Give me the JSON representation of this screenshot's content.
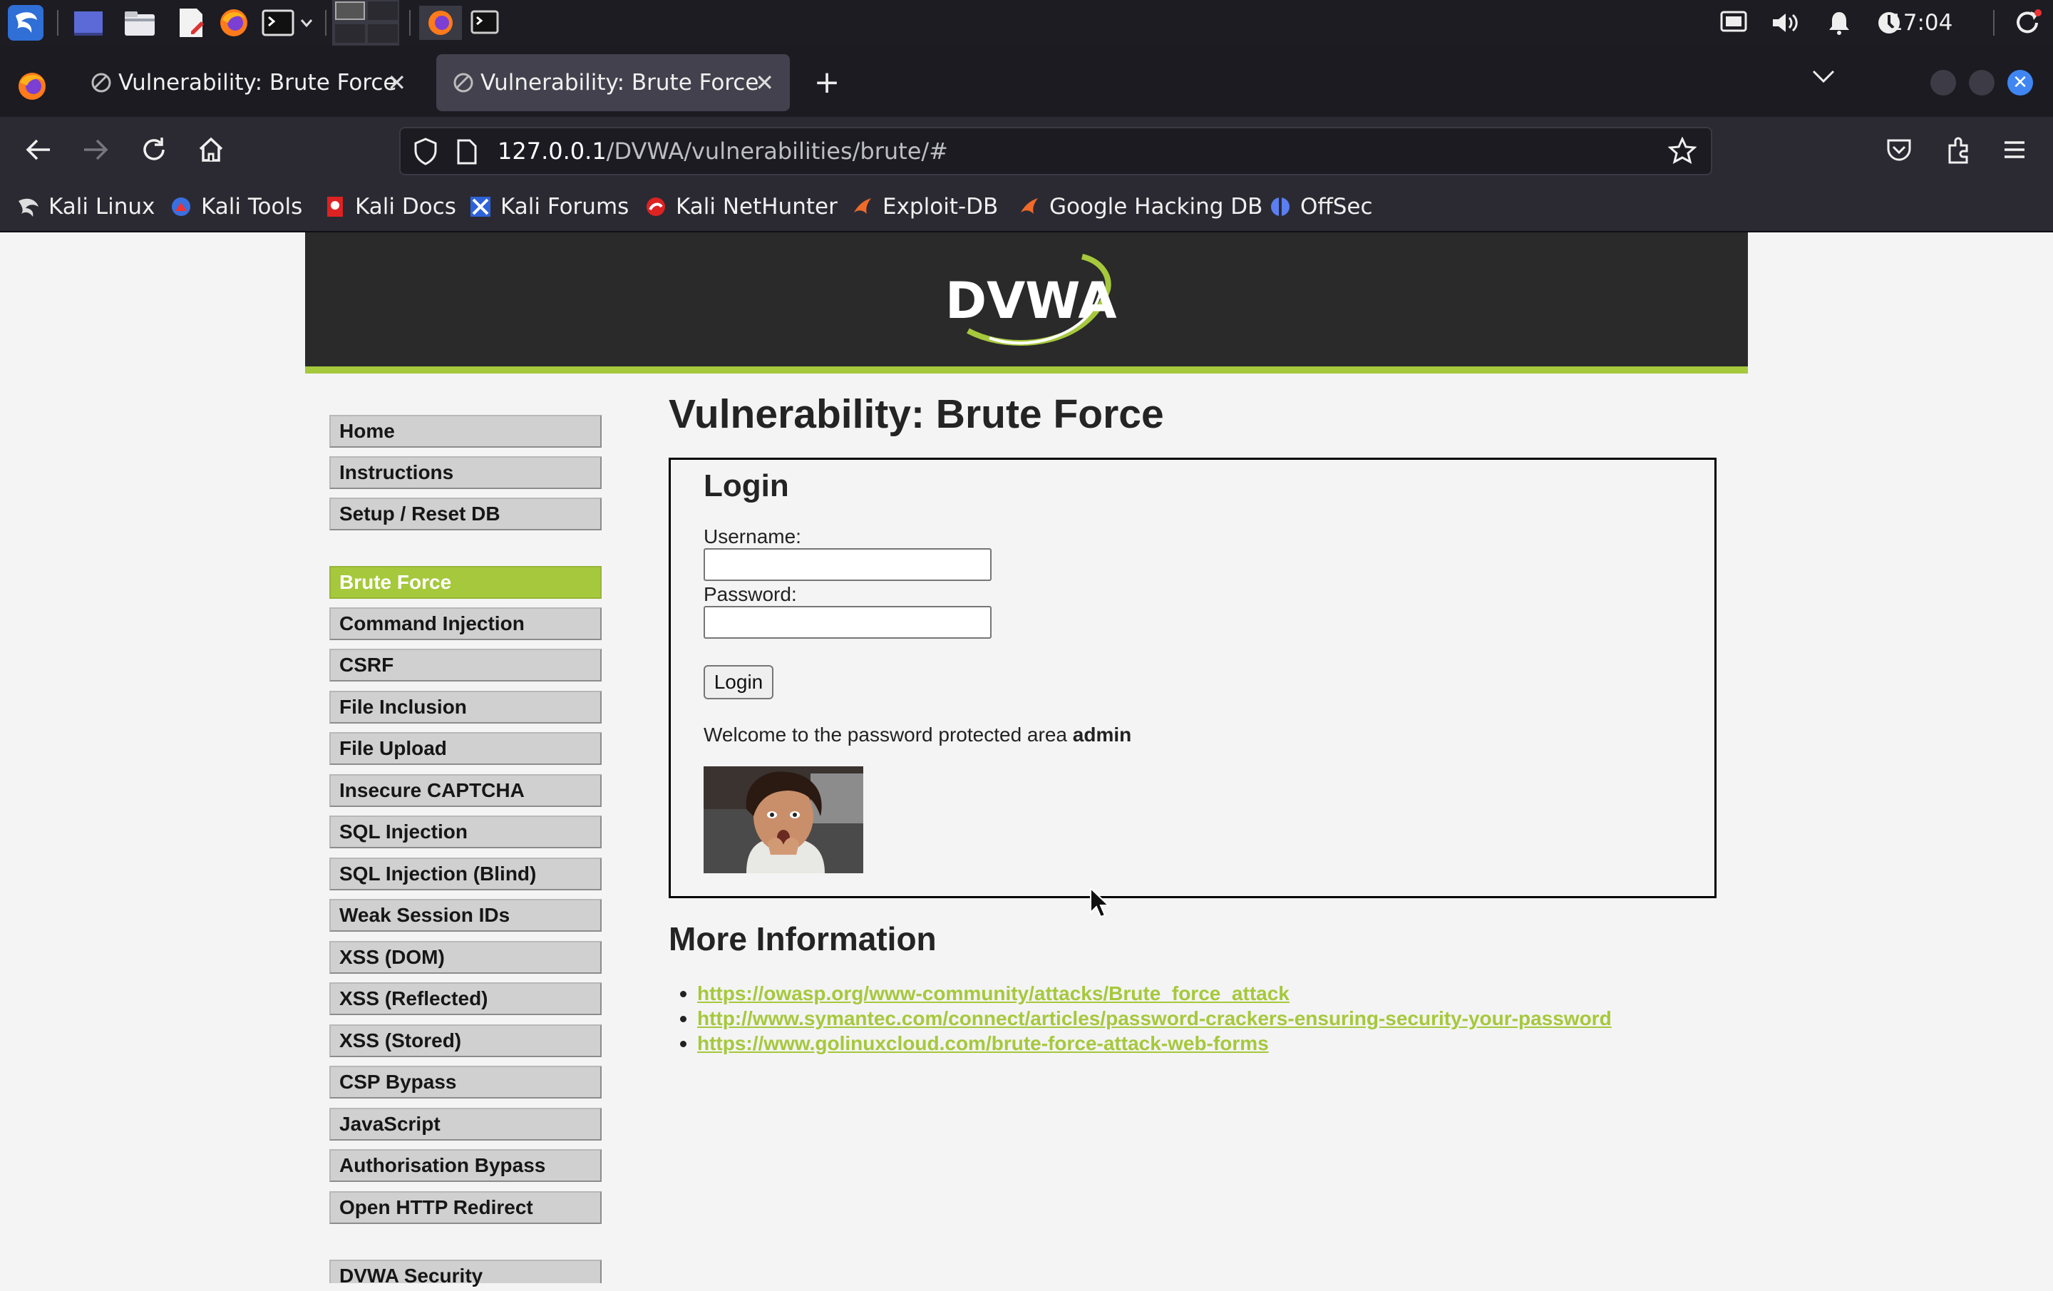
{
  "taskbar": {
    "clock": "17:04"
  },
  "tabs": [
    {
      "title": "Vulnerability: Brute Force",
      "active": false
    },
    {
      "title": "Vulnerability: Brute Force",
      "active": true
    }
  ],
  "nav": {
    "url_host": "127.0.0.1",
    "url_path": "/DVWA/vulnerabilities/brute/#"
  },
  "bookmarks": [
    "Kali Linux",
    "Kali Tools",
    "Kali Docs",
    "Kali Forums",
    "Kali NetHunter",
    "Exploit-DB",
    "Google Hacking DB",
    "OffSec"
  ],
  "header": {
    "logo_text": "DVWA"
  },
  "menu": {
    "group1": [
      "Home",
      "Instructions",
      "Setup / Reset DB"
    ],
    "group2": [
      "Brute Force",
      "Command Injection",
      "CSRF",
      "File Inclusion",
      "File Upload",
      "Insecure CAPTCHA",
      "SQL Injection",
      "SQL Injection (Blind)",
      "Weak Session IDs",
      "XSS (DOM)",
      "XSS (Reflected)",
      "XSS (Stored)",
      "CSP Bypass",
      "JavaScript",
      "Authorisation Bypass",
      "Open HTTP Redirect"
    ],
    "group3": [
      "DVWA Security"
    ],
    "selected": "Brute Force"
  },
  "main": {
    "title": "Vulnerability: Brute Force",
    "login_heading": "Login",
    "username_label": "Username:",
    "password_label": "Password:",
    "username_value": "",
    "password_value": "",
    "login_button": "Login",
    "welcome_text": "Welcome to the password protected area ",
    "welcome_user": "admin",
    "more_info_heading": "More Information",
    "links": [
      "https://owasp.org/www-community/attacks/Brute_force_attack",
      "http://www.symantec.com/connect/articles/password-crackers-ensuring-security-your-password",
      "https://www.golinuxcloud.com/brute-force-attack-web-forms"
    ]
  },
  "colors": {
    "accent_green": "#a6c83c",
    "header_bg": "#2a2a2a",
    "taskbar_bg": "#1c1c22",
    "tab_active_bg": "#42414d"
  },
  "icons": {
    "taskbar": [
      "kali-dragon-icon",
      "desktop-icon",
      "file-manager-icon",
      "text-editor-icon",
      "firefox-icon",
      "terminal-icon",
      "workspace-switcher-icon",
      "monitor-icon",
      "volume-icon",
      "bell-icon",
      "network-icon",
      "power-icon"
    ],
    "nav": [
      "back-icon",
      "forward-icon",
      "reload-icon",
      "home-icon",
      "shield-icon",
      "page-icon",
      "star-icon",
      "pocket-icon",
      "extensions-icon",
      "menu-icon"
    ]
  }
}
